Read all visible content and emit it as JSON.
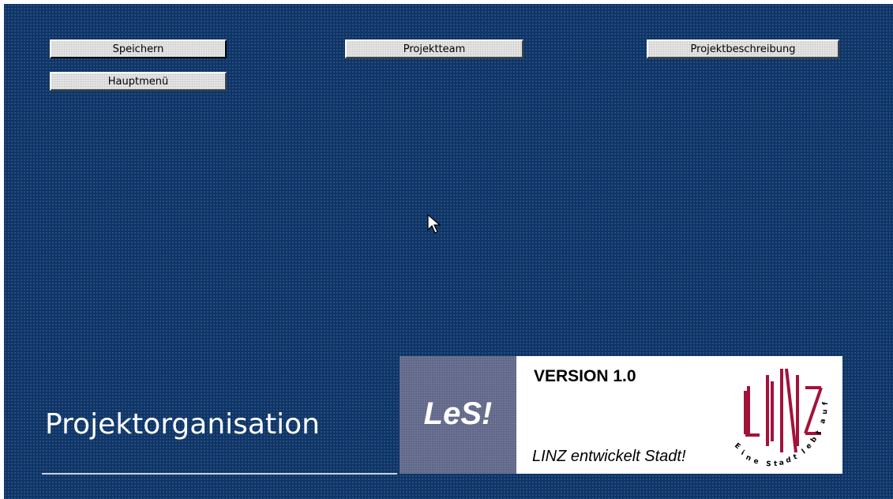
{
  "toolbar": {
    "save_label": "Speichern",
    "team_label": "Projektteam",
    "description_label": "Projektbeschreibung",
    "main_menu_label": "Hauptmenü"
  },
  "page": {
    "title": "Projektorganisation"
  },
  "branding": {
    "les_label": "LeS!",
    "version_label": "VERSION 1.0",
    "slogan": "LINZ entwickelt Stadt!",
    "linz_logo_text": "LINZ",
    "linz_logo_tagline": "Eine Stadt lebt auf"
  },
  "colors": {
    "background": "#0f3567",
    "button_face": "#e4e4e4",
    "les_box": "#5f6687",
    "linz_red": "#a3123a"
  },
  "icons": {
    "cursor": "arrow-cursor-icon"
  }
}
